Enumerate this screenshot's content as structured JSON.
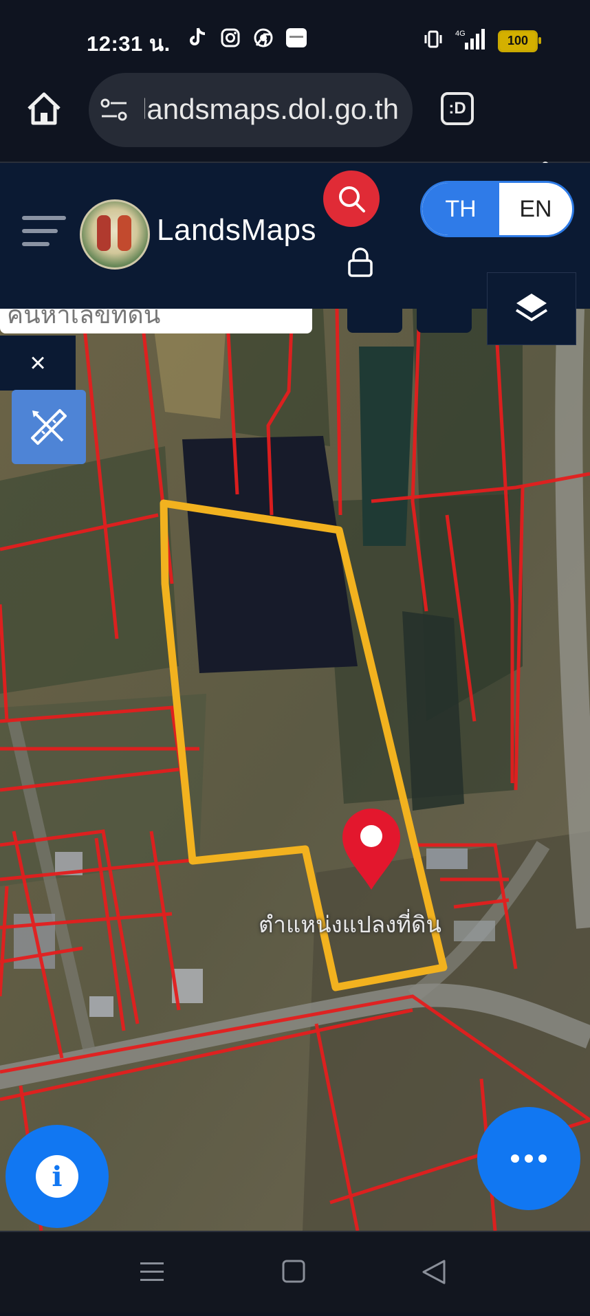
{
  "status_bar": {
    "time": "12:31 น.",
    "network": "4G",
    "battery": "100"
  },
  "browser": {
    "url": "landsmaps.dol.go.th",
    "tabs_label": ":D"
  },
  "app_header": {
    "brand": "LandsMaps",
    "lang_th": "TH",
    "lang_en": "EN"
  },
  "map": {
    "search_partial": "ค้นหาเลขที่ดิน",
    "marker_label": "ตำแหน่งแปลงที่ดิน",
    "close_label": "×",
    "info_label": "i"
  },
  "colors": {
    "header_bg": "#0b1a33",
    "accent_blue": "#1177f2",
    "search_red": "#e02b36",
    "parcel_highlight": "#f2b21f",
    "parcel_line": "#e41e1e"
  }
}
